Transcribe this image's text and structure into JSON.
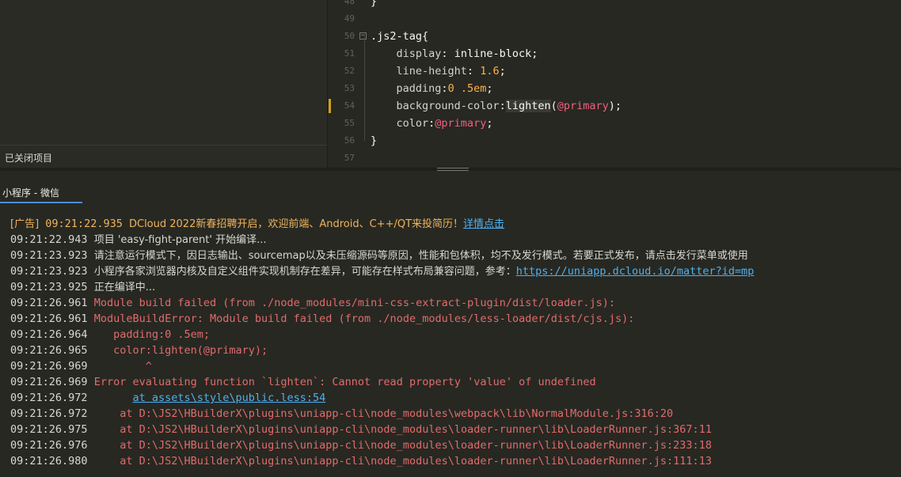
{
  "sidebar": {
    "closed_projects_label": "已关闭项目"
  },
  "editor": {
    "lines": [
      {
        "num": "48",
        "text": "}"
      },
      {
        "num": "49",
        "text": ""
      },
      {
        "num": "50",
        "selector": ".js2-tag",
        "brace": "{"
      },
      {
        "num": "51",
        "prop": "display",
        "value": "inline-block"
      },
      {
        "num": "52",
        "prop": "line-height",
        "value": "1.6"
      },
      {
        "num": "53",
        "prop": "padding",
        "value": "0 .5em"
      },
      {
        "num": "54",
        "prop": "background-color",
        "fn": "lighten",
        "arg": "@primary"
      },
      {
        "num": "55",
        "prop": "color",
        "value": "@primary"
      },
      {
        "num": "56",
        "text": "}"
      },
      {
        "num": "57",
        "text": ""
      }
    ],
    "colors": {
      "modified_marker": "#d4a016",
      "variable": "#f0607e",
      "number": "#ffb14a"
    }
  },
  "console": {
    "tab_label": "小程序 - 微信",
    "ad": {
      "tag": "[广告]",
      "time": "09:21:22.935",
      "text": "DCloud 2022新春招聘开启，欢迎前端、Android、C++/QT来投简历！",
      "link": "详情点击"
    },
    "rows": [
      {
        "time": "09:21:22.943",
        "text": "项目 'easy-fight-parent' 开始编译...",
        "kind": "info"
      },
      {
        "time": "09:21:23.923",
        "text": "请注意运行模式下，因日志输出、sourcemap以及未压缩源码等原因，性能和包体积，均不及发行模式。若要正式发布，请点击发行菜单或使用",
        "kind": "info"
      },
      {
        "time": "09:21:23.923",
        "text": "小程序各家浏览器内核及自定义组件实现机制存在差异，可能存在样式布局兼容问题，参考：",
        "link": "https://uniapp.dcloud.io/matter?id=mp",
        "kind": "info"
      },
      {
        "time": "09:21:23.925",
        "text": "正在编译中...",
        "kind": "info"
      },
      {
        "time": "09:21:26.961",
        "text": "Module build failed (from ./node_modules/mini-css-extract-plugin/dist/loader.js):",
        "kind": "err"
      },
      {
        "time": "09:21:26.961",
        "text": "ModuleBuildError: Module build failed (from ./node_modules/less-loader/dist/cjs.js):",
        "kind": "err"
      },
      {
        "time": "09:21:26.964",
        "text": "   padding:0 .5em;",
        "kind": "err"
      },
      {
        "time": "09:21:26.965",
        "text": "   color:lighten(@primary);",
        "kind": "err"
      },
      {
        "time": "09:21:26.969",
        "text": "        ^",
        "kind": "err"
      },
      {
        "time": "09:21:26.969",
        "text": "Error evaluating function `lighten`: Cannot read property 'value' of undefined",
        "kind": "err"
      },
      {
        "time": "09:21:26.972",
        "text": "",
        "link": "at assets\\style\\public.less:54",
        "kind": "link"
      },
      {
        "time": "09:21:26.972",
        "text": "    at D:\\JS2\\HBuilderX\\plugins\\uniapp-cli\\node_modules\\webpack\\lib\\NormalModule.js:316:20",
        "kind": "err"
      },
      {
        "time": "09:21:26.975",
        "text": "    at D:\\JS2\\HBuilderX\\plugins\\uniapp-cli\\node_modules\\loader-runner\\lib\\LoaderRunner.js:367:11",
        "kind": "err"
      },
      {
        "time": "09:21:26.976",
        "text": "    at D:\\JS2\\HBuilderX\\plugins\\uniapp-cli\\node_modules\\loader-runner\\lib\\LoaderRunner.js:233:18",
        "kind": "err"
      },
      {
        "time": "09:21:26.980",
        "text": "    at D:\\JS2\\HBuilderX\\plugins\\uniapp-cli\\node_modules\\loader-runner\\lib\\LoaderRunner.js:111:13",
        "kind": "err"
      }
    ]
  }
}
